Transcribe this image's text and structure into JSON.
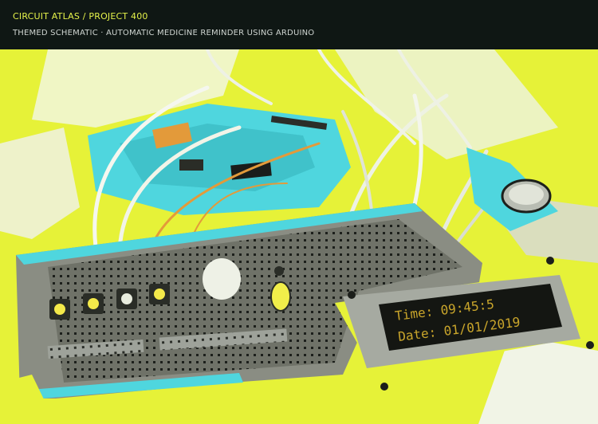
{
  "header": {
    "title": "CIRCUIT ATLAS / PROJECT 400",
    "subtitle": "THEMED SCHEMATIC · AUTOMATIC MEDICINE REMINDER USING ARDUINO"
  },
  "photo": {
    "lcd_line1": "Time: 09:45:5",
    "lcd_line2": "Date: 01/01/2019"
  },
  "colors": {
    "header_bg": "#0f1714",
    "title": "#e5f24a",
    "subtitle": "#cfd5d1",
    "yellow": "#e9f53a",
    "cyan": "#4fd6de",
    "orange": "#e39a3a",
    "lcd_text": "#c9a52b"
  }
}
